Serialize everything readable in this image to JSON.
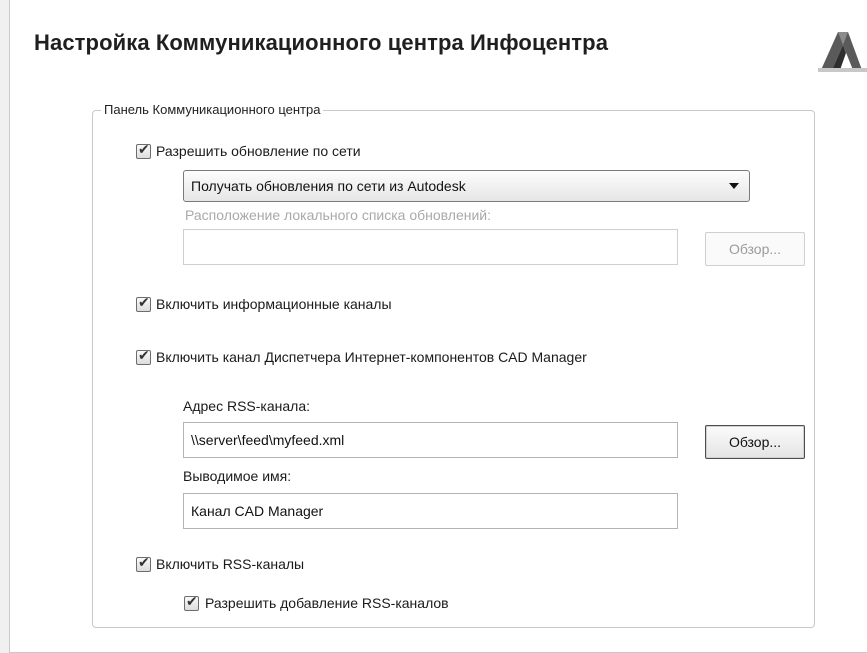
{
  "dialog": {
    "title": "Настройка Коммуникационного центра Инфоцентра"
  },
  "group": {
    "label": "Панель Коммуникационного центра"
  },
  "update": {
    "checkbox_label": "Разрешить обновление по сети",
    "checked": true,
    "source_selected": "Получать обновления по сети из Autodesk",
    "local_list_label": "Расположение локального списка обновлений:",
    "local_list_value": "",
    "browse_label": "Обзор..."
  },
  "info_channels": {
    "checkbox_label": "Включить информационные каналы",
    "checked": true
  },
  "cad_manager": {
    "checkbox_label": "Включить канал Диспетчера Интернет-компонентов CAD Manager",
    "checked": true,
    "rss_address_label": "Адрес RSS-канала:",
    "rss_address_value": "\\\\server\\feed\\myfeed.xml",
    "browse_label": "Обзор...",
    "display_name_label": "Выводимое имя:",
    "display_name_value": "Канал CAD Manager"
  },
  "rss": {
    "checkbox_label": "Включить RSS-каналы",
    "checked": true,
    "allow_add_label": "Разрешить добавление RSS-каналов",
    "allow_add_checked": true
  },
  "icons": {
    "logo": "autocad-logo-icon",
    "dropdown": "chevron-down-icon"
  }
}
